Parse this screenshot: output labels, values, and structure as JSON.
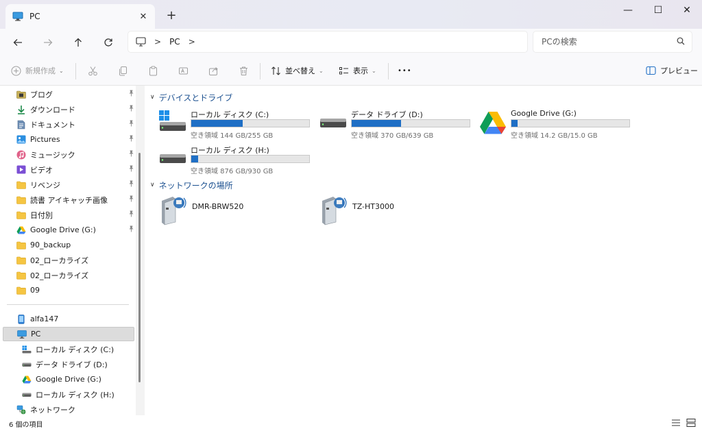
{
  "tab": {
    "title": "PC",
    "close_glyph": "✕",
    "new_glyph": "+"
  },
  "window_controls": {
    "minimize": "—",
    "maximize": "☐",
    "close": "✕"
  },
  "address": {
    "crumbs": [
      "PC"
    ],
    "sep": ">"
  },
  "search": {
    "placeholder": "PCの検索"
  },
  "commands": {
    "new_label": "新規作成",
    "sort_label": "並べ替え",
    "view_label": "表示",
    "more_glyph": "•••",
    "preview_label": "プレビュー"
  },
  "sidebar": {
    "quick_access": [
      {
        "label": "ブログ",
        "icon": "blog-folder-icon",
        "pinned": true
      },
      {
        "label": "ダウンロード",
        "icon": "download-arrow-icon",
        "pinned": true
      },
      {
        "label": "ドキュメント",
        "icon": "document-icon",
        "pinned": true
      },
      {
        "label": "Pictures",
        "icon": "pictures-icon",
        "pinned": true
      },
      {
        "label": "ミュージック",
        "icon": "music-icon",
        "pinned": true
      },
      {
        "label": "ビデオ",
        "icon": "video-icon",
        "pinned": true
      },
      {
        "label": "リベンジ",
        "icon": "folder-icon",
        "pinned": true
      },
      {
        "label": "読書 アイキャッチ画像",
        "icon": "folder-icon",
        "pinned": true
      },
      {
        "label": "日付別",
        "icon": "folder-icon",
        "pinned": true
      },
      {
        "label": "Google Drive (G:)",
        "icon": "google-drive-icon",
        "pinned": true
      },
      {
        "label": "90_backup",
        "icon": "folder-icon",
        "pinned": false
      },
      {
        "label": "02_ローカライズ",
        "icon": "folder-icon",
        "pinned": false
      },
      {
        "label": "02_ローカライズ",
        "icon": "folder-icon",
        "pinned": false
      },
      {
        "label": "09",
        "icon": "folder-icon",
        "pinned": false
      }
    ],
    "devices": [
      {
        "label": "alfa147",
        "icon": "phone-icon",
        "sub": false
      },
      {
        "label": "PC",
        "icon": "pc-monitor-icon",
        "sub": false,
        "selected": true
      },
      {
        "label": "ローカル ディスク (C:)",
        "icon": "windows-drive-icon",
        "sub": true
      },
      {
        "label": "データ ドライブ (D:)",
        "icon": "drive-icon",
        "sub": true
      },
      {
        "label": "Google Drive (G:)",
        "icon": "google-drive-icon",
        "sub": true
      },
      {
        "label": "ローカル ディスク (H:)",
        "icon": "drive-icon",
        "sub": true
      },
      {
        "label": "ネットワーク",
        "icon": "network-icon",
        "sub": false
      }
    ]
  },
  "main": {
    "devices_header": "デバイスとドライブ",
    "network_header": "ネットワークの場所",
    "drives": [
      {
        "name": "ローカル ディスク (C:)",
        "free": "空き領域 144 GB/255 GB",
        "used_fraction": 0.435,
        "icon": "windows-drive-icon"
      },
      {
        "name": "データ ドライブ (D:)",
        "free": "空き領域 370 GB/639 GB",
        "used_fraction": 0.42,
        "icon": "drive-icon"
      },
      {
        "name": "Google Drive (G:)",
        "free": "空き領域 14.2 GB/15.0 GB",
        "used_fraction": 0.053,
        "icon": "google-drive-icon"
      },
      {
        "name": "ローカル ディスク (H:)",
        "free": "空き領域 876 GB/930 GB",
        "used_fraction": 0.058,
        "icon": "drive-icon"
      }
    ],
    "network": [
      {
        "name": "DMR-BRW520",
        "icon": "media-server-icon"
      },
      {
        "name": "TZ-HT3000",
        "icon": "media-server-icon"
      }
    ]
  },
  "status": {
    "item_count": "6 個の項目"
  },
  "colors": {
    "accent": "#1f6fc5",
    "header_text": "#1a4f8f",
    "folder": "#f5c542"
  }
}
